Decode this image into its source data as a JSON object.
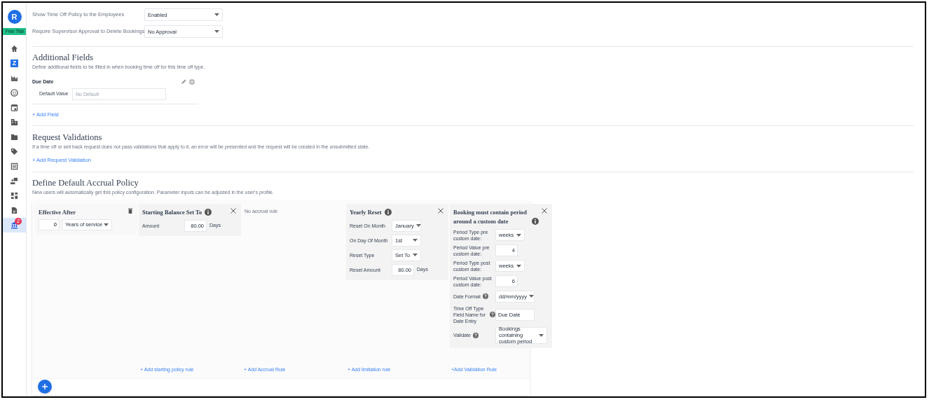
{
  "sidebar": {
    "logo": "R",
    "trial_badge": "Free Trial",
    "items": [
      {
        "selected": false
      },
      {
        "selected": false,
        "label": "Z"
      },
      {
        "selected": false
      },
      {
        "selected": false
      },
      {
        "selected": false
      },
      {
        "selected": false
      },
      {
        "selected": false
      },
      {
        "selected": false
      },
      {
        "selected": false
      },
      {
        "selected": false
      },
      {
        "selected": false
      },
      {
        "selected": false
      },
      {
        "selected": true,
        "badge": "2"
      }
    ]
  },
  "settings": [
    {
      "label": "Show Time Off Policy to the Employees",
      "value": "Enabled"
    },
    {
      "label": "Require Supervisor Approval to Delete Bookings",
      "value": "No Approval"
    }
  ],
  "additional_fields": {
    "title": "Additional Fields",
    "description": "Define additional fields to be filled in when booking time off for this time off type.",
    "fields": [
      {
        "name": "Due Date",
        "default_label": "Default Value",
        "placeholder": "No Default"
      }
    ],
    "add_link": "+ Add Field"
  },
  "request_validations": {
    "title": "Request Validations",
    "description": "If a time off or sell back request does not pass validations that apply to it, an error will be presented and the request will be created in the unsubmitted state.",
    "add_link": "+ Add Request Validation"
  },
  "accrual_policy": {
    "title": "Define Default Accrual Policy",
    "description": "New users will automatically get this policy configuration. Parameter inputs can be adjusted in the user's profile.",
    "columns": [
      {
        "kind": "effective",
        "title": "Effective After",
        "deletable": true,
        "value": "0",
        "unit_select": "Years of service"
      },
      {
        "kind": "card",
        "title": "Starting Balance Set To",
        "info": true,
        "closable": true,
        "rows": [
          {
            "label": "Amount",
            "kind": "input",
            "value": "80.00",
            "unit": "Days"
          }
        ],
        "add_link": "+ Add starting policy rule"
      },
      {
        "kind": "empty",
        "text": "No accrual rule",
        "add_link": "+ Add Accrual Rule"
      },
      {
        "kind": "card",
        "title": "Yearly Reset",
        "info": true,
        "closable": true,
        "rows": [
          {
            "label": "Reset On Month",
            "kind": "select",
            "value": "January"
          },
          {
            "label": "On Day Of Month",
            "kind": "select",
            "value": "1st"
          },
          {
            "label": "Reset Type",
            "kind": "select",
            "value": "Set To"
          },
          {
            "label": "Reset Amount",
            "kind": "input",
            "value": "80.00",
            "unit": "Days"
          }
        ],
        "add_link": "+ Add limitation rule"
      },
      {
        "kind": "card",
        "title": "Booking must contain period around a custom date",
        "info": true,
        "closable": true,
        "rows": [
          {
            "label": "Period Type pre custom date:",
            "kind": "select",
            "value": "weeks",
            "help": false
          },
          {
            "label": "Period Value pre custom date:",
            "kind": "input",
            "value": "4",
            "help": false
          },
          {
            "label": "Period Type post custom date:",
            "kind": "select",
            "value": "weeks",
            "help": false
          },
          {
            "label": "Period Value post custom date:",
            "kind": "input",
            "value": "6",
            "help": false
          },
          {
            "label": "Date Format",
            "kind": "select",
            "value": "dd/mm/yyyy",
            "help": true
          },
          {
            "label": "Time Off Type Field Name for Date Entry",
            "kind": "text",
            "value": "Due Date",
            "help": true
          },
          {
            "label": "Validate",
            "kind": "select",
            "value": "Bookings containing custom period",
            "help": true
          }
        ],
        "add_link": "+Add Validation Rule"
      }
    ]
  }
}
